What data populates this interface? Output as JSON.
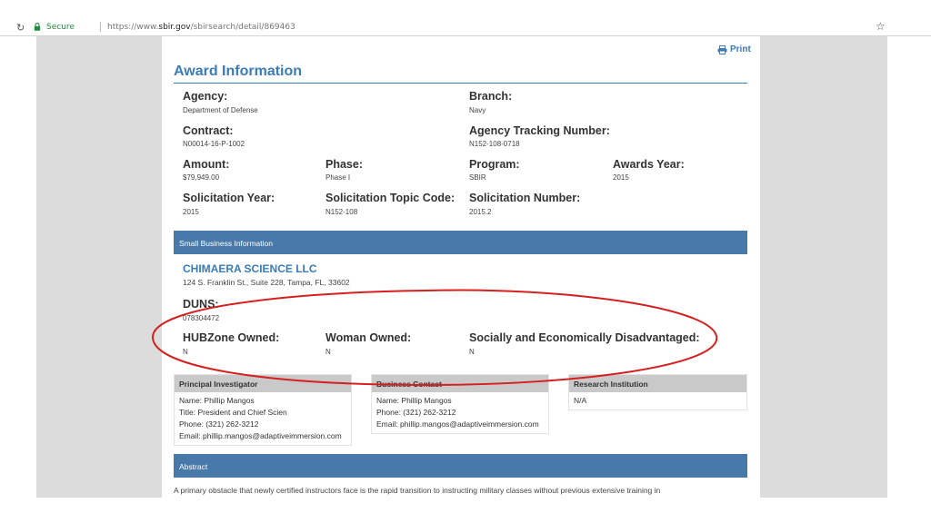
{
  "browser": {
    "secure_label": "Secure",
    "url_prefix": "https://www.",
    "url_host": "sbir.gov",
    "url_path": "/sbirsearch/detail/869463"
  },
  "header": {
    "print_label": "Print",
    "title": "Award Information"
  },
  "award": {
    "agency": {
      "label": "Agency:",
      "value": "Department of Defense"
    },
    "branch": {
      "label": "Branch:",
      "value": "Navy"
    },
    "contract": {
      "label": "Contract:",
      "value": "N00014-16-P-1002"
    },
    "tracking": {
      "label": "Agency Tracking Number:",
      "value": "N152-108-0718"
    },
    "amount": {
      "label": "Amount:",
      "value": "$79,949.00"
    },
    "phase": {
      "label": "Phase:",
      "value": "Phase I"
    },
    "program": {
      "label": "Program:",
      "value": "SBIR"
    },
    "awards_year": {
      "label": "Awards Year:",
      "value": "2015"
    },
    "solicitation_year": {
      "label": "Solicitation Year:",
      "value": "2015"
    },
    "topic_code": {
      "label": "Solicitation Topic Code:",
      "value": "N152-108"
    },
    "solicitation_number": {
      "label": "Solicitation Number:",
      "value": "2015.2"
    }
  },
  "small_business": {
    "section_title": "Small Business Information",
    "name": "CHIMAERA SCIENCE LLC",
    "address": "124 S. Franklin St., Suite 228, Tampa, FL, 33602",
    "duns": {
      "label": "DUNS:",
      "value": "078304472"
    },
    "hubzone": {
      "label": "HUBZone Owned:",
      "value": "N"
    },
    "woman": {
      "label": "Woman Owned:",
      "value": "N"
    },
    "disadvantaged": {
      "label": "Socially and Economically Disadvantaged:",
      "value": "N"
    }
  },
  "principal_investigator": {
    "title": "Principal Investigator",
    "lines": [
      "Name: Phillip Mangos",
      "Title: President and Chief Scien",
      "Phone: (321) 262-3212",
      "Email: phillip.mangos@adaptiveimmersion.com"
    ]
  },
  "business_contact": {
    "title": "Business Contact",
    "lines": [
      "Name: Phillip Mangos",
      "Phone: (321) 262-3212",
      "Email: phillip.mangos@adaptiveimmersion.com"
    ]
  },
  "research_institution": {
    "title": "Research Institution",
    "lines": [
      "N/A"
    ]
  },
  "abstract": {
    "section_title": "Abstract",
    "text": "A primary obstacle that newly certified instructors face is the rapid transition to instructing military classes without previous extensive training in"
  },
  "colors": {
    "accent": "#3a7cb8",
    "band": "#4779ab",
    "annotation": "#d62020"
  }
}
